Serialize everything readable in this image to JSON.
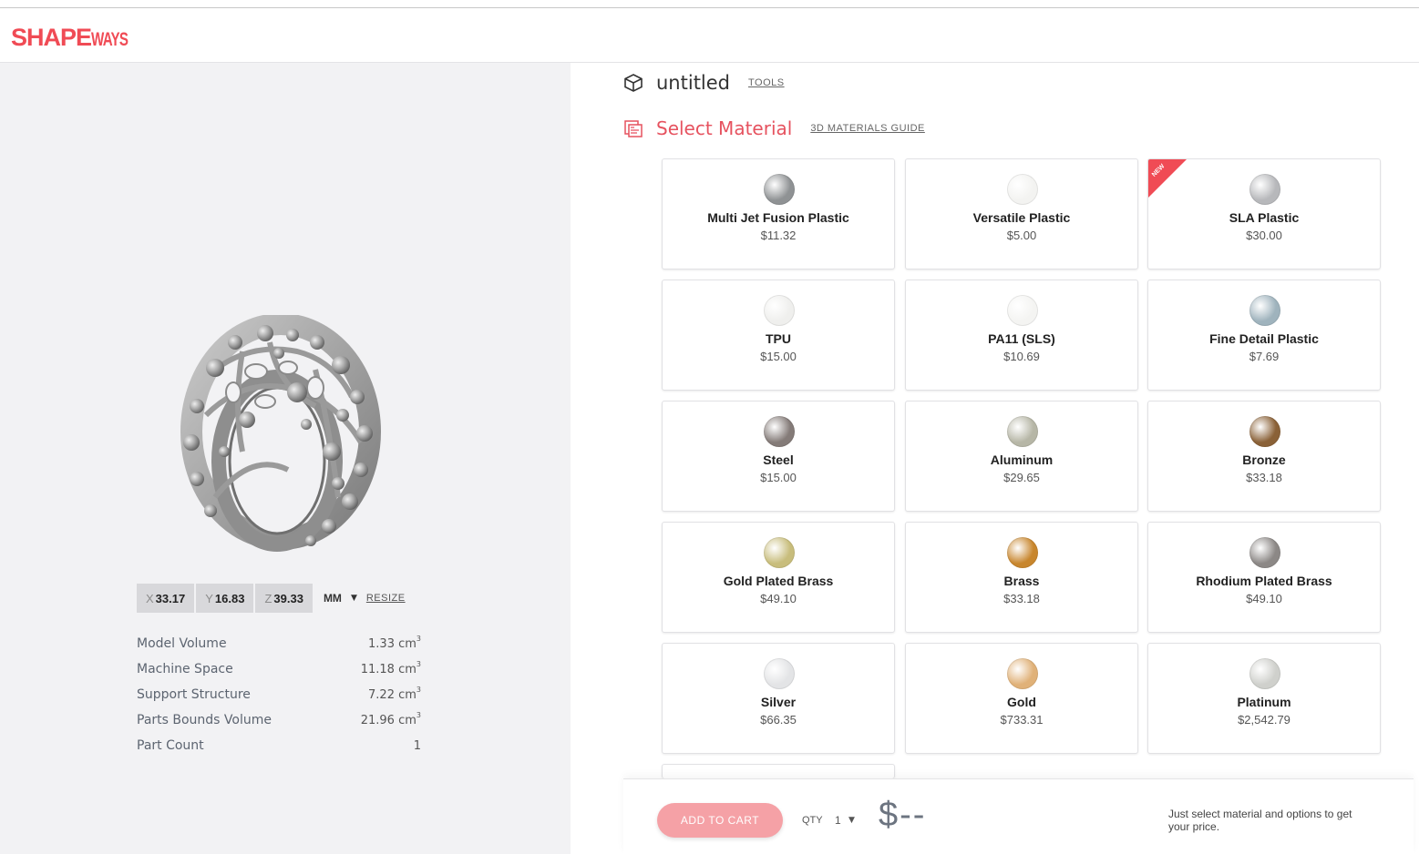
{
  "header": {
    "logo_main": "SHAPE",
    "logo_sub": "WAYS",
    "brand_color": "#f04b55"
  },
  "model": {
    "title": "untitled",
    "tools_label": "TOOLS",
    "dims": {
      "x_axis": "X",
      "x": "33.17",
      "y_axis": "Y",
      "y": "16.83",
      "z_axis": "Z",
      "z": "39.33",
      "unit": "MM",
      "resize_label": "RESIZE"
    },
    "stats": [
      {
        "label": "Model Volume",
        "value": "1.33 cm",
        "sup": "3"
      },
      {
        "label": "Machine Space",
        "value": "11.18 cm",
        "sup": "3"
      },
      {
        "label": "Support Structure",
        "value": "7.22 cm",
        "sup": "3"
      },
      {
        "label": "Parts Bounds Volume",
        "value": "21.96 cm",
        "sup": "3"
      },
      {
        "label": "Part Count",
        "value": "1",
        "sup": ""
      }
    ]
  },
  "materials": {
    "title": "Select Material",
    "guide_label": "3D MATERIALS GUIDE",
    "new_badge": "NEW",
    "items": [
      {
        "name": "Multi Jet Fusion Plastic",
        "price": "$11.32",
        "swatch": "#8f9294",
        "is_new": false
      },
      {
        "name": "Versatile Plastic",
        "price": "$5.00",
        "swatch": "#f3f3f1",
        "is_new": false
      },
      {
        "name": "SLA Plastic",
        "price": "$30.00",
        "swatch": "#b7b8bb",
        "is_new": true
      },
      {
        "name": "TPU",
        "price": "$15.00",
        "swatch": "#efefed",
        "is_new": false
      },
      {
        "name": "PA11 (SLS)",
        "price": "$10.69",
        "swatch": "#f4f4f2",
        "is_new": false
      },
      {
        "name": "Fine Detail Plastic",
        "price": "$7.69",
        "swatch": "#9fb3bd",
        "is_new": false
      },
      {
        "name": "Steel",
        "price": "$15.00",
        "swatch": "#847b78",
        "is_new": false
      },
      {
        "name": "Aluminum",
        "price": "$29.65",
        "swatch": "#b6b6a6",
        "is_new": false
      },
      {
        "name": "Bronze",
        "price": "$33.18",
        "swatch": "#8a6137",
        "is_new": false
      },
      {
        "name": "Gold Plated Brass",
        "price": "$49.10",
        "swatch": "#c8bd7c",
        "is_new": false
      },
      {
        "name": "Brass",
        "price": "$33.18",
        "swatch": "#c8862d",
        "is_new": false
      },
      {
        "name": "Rhodium Plated Brass",
        "price": "$49.10",
        "swatch": "#8c8886",
        "is_new": false
      },
      {
        "name": "Silver",
        "price": "$66.35",
        "swatch": "#e3e4e6",
        "is_new": false
      },
      {
        "name": "Gold",
        "price": "$733.31",
        "swatch": "#e0b178",
        "is_new": false
      },
      {
        "name": "Platinum",
        "price": "$2,542.79",
        "swatch": "#cfd0cc",
        "is_new": false
      }
    ]
  },
  "cart": {
    "add_label": "ADD TO CART",
    "qty_label": "QTY",
    "qty_value": "1",
    "price": "$--",
    "hint": "Just select material and options to get your price.",
    "button_color": "#f5a1a6"
  }
}
